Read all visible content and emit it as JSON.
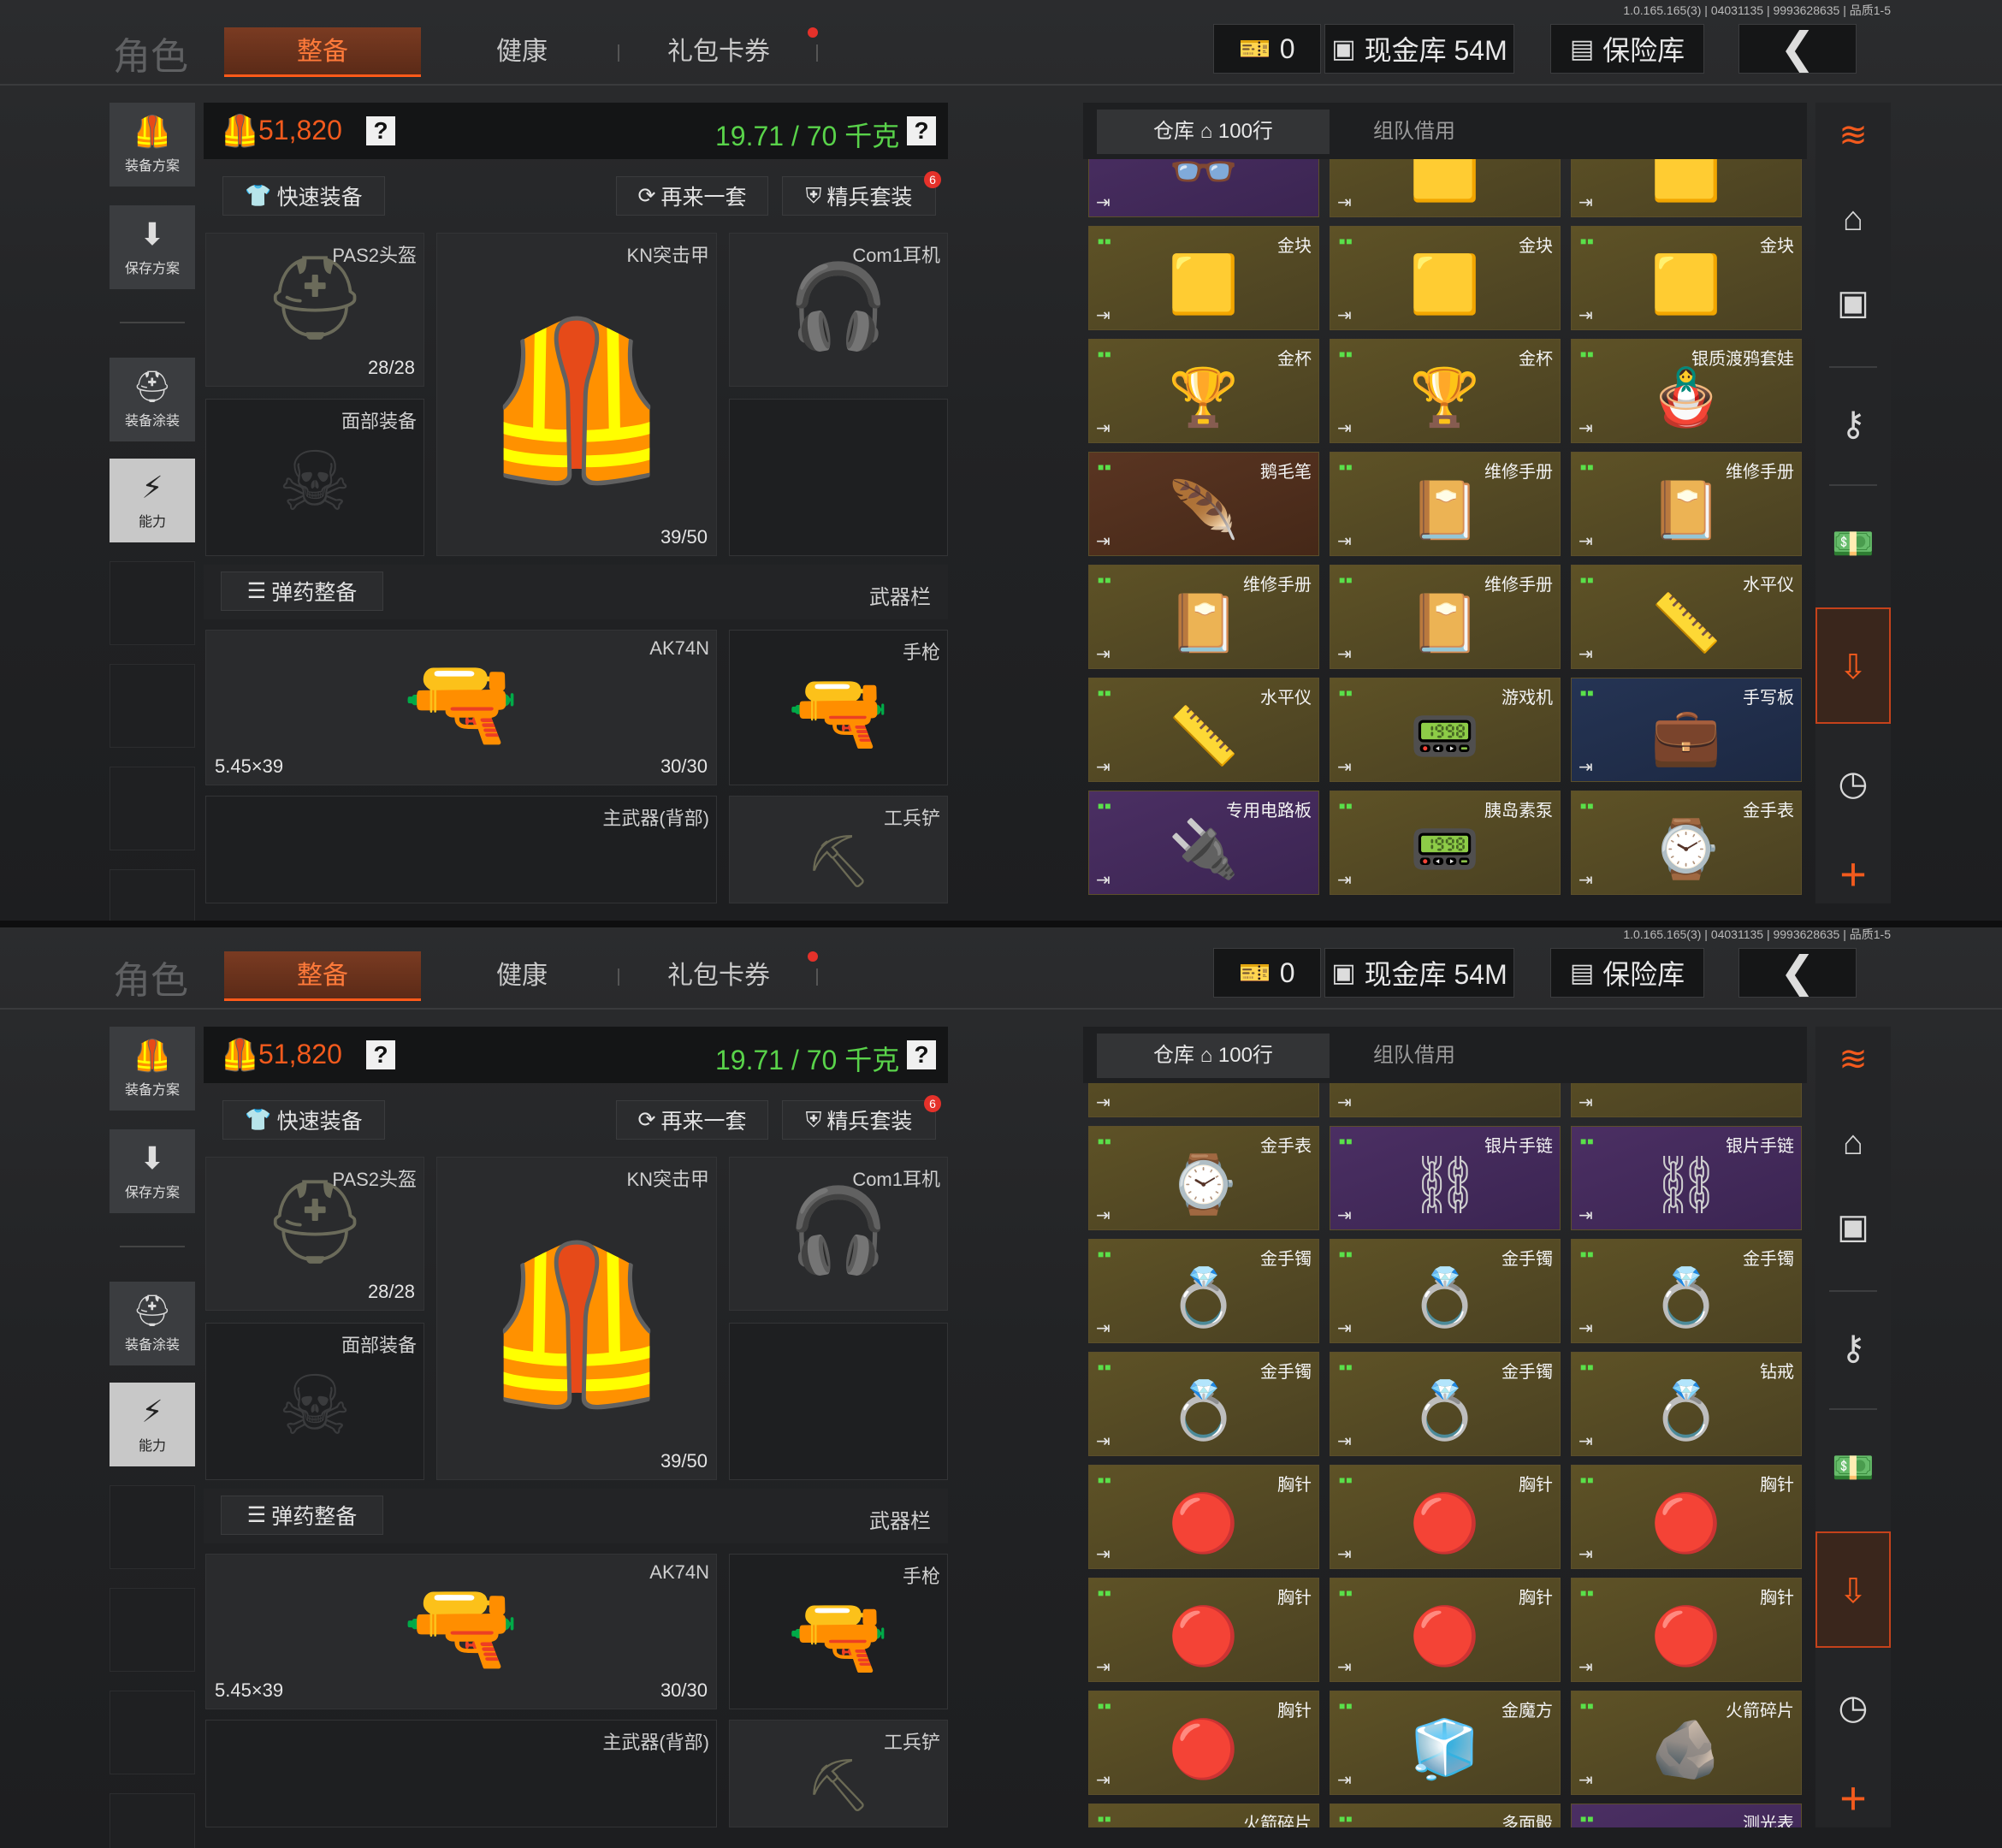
{
  "version": "1.0.165.165(3) | 04031135 | 9993628635 | 品质1-5",
  "header": {
    "role": "角色",
    "tabs": [
      {
        "label": "整备"
      },
      {
        "label": "健康"
      },
      {
        "label": "礼包卡券"
      }
    ],
    "tickets": "0",
    "cash_vault": "现金库 54M",
    "safe": "保险库",
    "back_icon": "chevron-left-icon"
  },
  "left_nav": [
    {
      "label": "装备方案",
      "icon": "vest-icon"
    },
    {
      "label": "保存方案",
      "icon": "download-icon"
    },
    {
      "label": "装备涂装",
      "icon": "paint-icon"
    },
    {
      "label": "能力",
      "icon": "lightning-icon"
    }
  ],
  "loadout": {
    "money": "51,820",
    "weight": "19.71 / 70 千克",
    "help": "?",
    "quick_equip": "快速装备",
    "again": "再来一套",
    "elite": "精兵套装",
    "elite_badge": "6",
    "helmet": {
      "name": "PAS2头盔",
      "count": "28/28"
    },
    "armor": {
      "name": "KN突击甲",
      "count": "39/50"
    },
    "headset": {
      "name": "Com1耳机"
    },
    "face": {
      "name": "面部装备"
    },
    "ammo_btn": "弹药整备",
    "weapon_bar": "武器栏",
    "primary": {
      "name": "AK74N",
      "caliber": "5.45×39",
      "count": "30/30"
    },
    "pistol": {
      "name": "手枪"
    },
    "secondary": {
      "name": "主武器(背部)"
    },
    "shovel": {
      "name": "工兵铲"
    }
  },
  "warehouse": {
    "tab_label": "仓库",
    "rows": "100行",
    "team_tab": "组队借用"
  },
  "sidebar_icons": [
    "stack-icon",
    "home-icon",
    "safe-icon",
    "key-icon",
    "cash-icon",
    "inventory-icon",
    "clock-icon",
    "plus-icon"
  ],
  "top_grid": [
    {
      "name": "",
      "color": "purple",
      "pic": "👓"
    },
    {
      "name": "",
      "color": "gold",
      "pic": "🟨"
    },
    {
      "name": "",
      "color": "gold",
      "pic": "🟨"
    },
    {
      "name": "金块",
      "color": "gold",
      "pic": "🟨"
    },
    {
      "name": "金块",
      "color": "gold",
      "pic": "🟨"
    },
    {
      "name": "金块",
      "color": "gold",
      "pic": "🟨"
    },
    {
      "name": "金杯",
      "color": "gold",
      "pic": "🏆"
    },
    {
      "name": "金杯",
      "color": "gold",
      "pic": "🏆"
    },
    {
      "name": "银质渡鸦套娃",
      "color": "gold",
      "pic": "🪆"
    },
    {
      "name": "鹅毛笔",
      "color": "brown",
      "pic": "🪶"
    },
    {
      "name": "维修手册",
      "color": "gold",
      "pic": "📔"
    },
    {
      "name": "维修手册",
      "color": "gold",
      "pic": "📔"
    },
    {
      "name": "维修手册",
      "color": "gold",
      "pic": "📔"
    },
    {
      "name": "维修手册",
      "color": "gold",
      "pic": "📔"
    },
    {
      "name": "水平仪",
      "color": "gold",
      "pic": "📏"
    },
    {
      "name": "水平仪",
      "color": "gold",
      "pic": "📏"
    },
    {
      "name": "游戏机",
      "color": "gold",
      "pic": "📟"
    },
    {
      "name": "手写板",
      "color": "blue",
      "pic": "💼"
    },
    {
      "name": "专用电路板",
      "color": "purple",
      "pic": "🔌"
    },
    {
      "name": "胰岛素泵",
      "color": "gold",
      "pic": "📟"
    },
    {
      "name": "金手表",
      "color": "gold",
      "pic": "⌚"
    }
  ],
  "bottom_grid": [
    {
      "name": "",
      "color": "gold",
      "pic": ""
    },
    {
      "name": "",
      "color": "gold",
      "pic": ""
    },
    {
      "name": "",
      "color": "gold",
      "pic": ""
    },
    {
      "name": "金手表",
      "color": "gold",
      "pic": "⌚"
    },
    {
      "name": "银片手链",
      "color": "purple",
      "pic": "⛓"
    },
    {
      "name": "银片手链",
      "color": "purple",
      "pic": "⛓"
    },
    {
      "name": "金手镯",
      "color": "gold",
      "pic": "💍"
    },
    {
      "name": "金手镯",
      "color": "gold",
      "pic": "💍"
    },
    {
      "name": "金手镯",
      "color": "gold",
      "pic": "💍"
    },
    {
      "name": "金手镯",
      "color": "gold",
      "pic": "💍"
    },
    {
      "name": "金手镯",
      "color": "gold",
      "pic": "💍"
    },
    {
      "name": "钻戒",
      "color": "gold",
      "pic": "💍"
    },
    {
      "name": "胸针",
      "color": "gold",
      "pic": "🔴"
    },
    {
      "name": "胸针",
      "color": "gold",
      "pic": "🔴"
    },
    {
      "name": "胸针",
      "color": "gold",
      "pic": "🔴"
    },
    {
      "name": "胸针",
      "color": "gold",
      "pic": "🔴"
    },
    {
      "name": "胸针",
      "color": "gold",
      "pic": "🔴"
    },
    {
      "name": "胸针",
      "color": "gold",
      "pic": "🔴"
    },
    {
      "name": "胸针",
      "color": "gold",
      "pic": "🔴"
    },
    {
      "name": "金魔方",
      "color": "gold",
      "pic": "🧊"
    },
    {
      "name": "火箭碎片",
      "color": "gold",
      "pic": "🪨"
    },
    {
      "name": "火箭碎片",
      "color": "gold",
      "pic": "🪨"
    },
    {
      "name": "多面骰",
      "color": "gold",
      "pic": "🎲"
    },
    {
      "name": "测光表",
      "color": "purple",
      "pic": "📷"
    }
  ]
}
